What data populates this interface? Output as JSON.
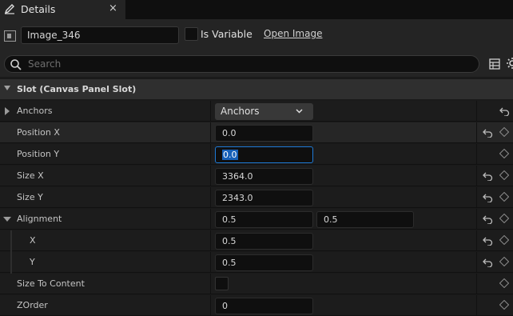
{
  "tab": {
    "title": "Details",
    "close": "×"
  },
  "header": {
    "name_value": "Image_346",
    "is_variable_label": "Is Variable",
    "open_image_label": "Open Image"
  },
  "search": {
    "placeholder": "Search"
  },
  "section": {
    "title": "Slot (Canvas Panel Slot)"
  },
  "properties": [
    {
      "label": "Anchors",
      "value": "Anchors"
    },
    {
      "label": "Position X",
      "value": "0.0"
    },
    {
      "label": "Position Y",
      "value": "0.0"
    },
    {
      "label": "Size X",
      "value": "3364.0"
    },
    {
      "label": "Size Y",
      "value": "2343.0"
    },
    {
      "label": "Alignment",
      "value_x": "0.5",
      "value_y": "0.5"
    },
    {
      "label": "X",
      "value": "0.5"
    },
    {
      "label": "Y",
      "value": "0.5"
    },
    {
      "label": "Size To Content"
    },
    {
      "label": "ZOrder",
      "value": "0"
    }
  ],
  "colors": {
    "accent": "#1e7ad6",
    "selection": "#1660b8",
    "panel": "#1c1c1c"
  }
}
